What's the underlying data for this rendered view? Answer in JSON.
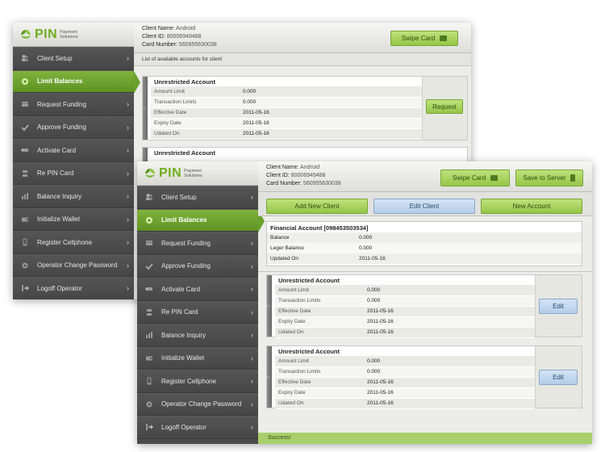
{
  "brand": {
    "logo": "PIN",
    "sub": "Payment Solutions",
    "accent": "#6fae1f"
  },
  "client": {
    "name_label": "Client Name:",
    "name": "Android",
    "id_label": "Client ID:",
    "id": "80006949488",
    "card_label": "Card Number:",
    "card": "560955630038"
  },
  "nav": [
    {
      "label": "Client Setup",
      "icon": "users-icon"
    },
    {
      "label": "Limit Balances",
      "icon": "balance-icon",
      "active": true
    },
    {
      "label": "Request Funding",
      "icon": "funding-icon"
    },
    {
      "label": "Approve Funding",
      "icon": "check-icon"
    },
    {
      "label": "Activate Card",
      "icon": "card-icon"
    },
    {
      "label": "Re PIN Card",
      "icon": "pin-icon"
    },
    {
      "label": "Balance Inquiry",
      "icon": "chart-icon"
    },
    {
      "label": "Initialize Wallet",
      "icon": "wallet-icon"
    },
    {
      "label": "Register Cellphone",
      "icon": "phone-icon"
    },
    {
      "label": "Operator Change Password",
      "icon": "lock-icon"
    },
    {
      "label": "Logoff Operator",
      "icon": "logout-icon"
    }
  ],
  "back": {
    "swipe_label": "Swipe Card",
    "list_caption": "List of available accounts for client",
    "request_label": "Request",
    "account1": {
      "title": "Unrestricted Account",
      "rows": [
        {
          "k": "Amount Limit",
          "v": "0.000"
        },
        {
          "k": "Transaction Limits",
          "v": "0.000"
        },
        {
          "k": "Effective Date",
          "v": "2011-05-16"
        },
        {
          "k": "Expiry Date",
          "v": "2011-05-16"
        },
        {
          "k": "Udated On",
          "v": "2011-05-16"
        }
      ]
    },
    "account2_title": "Unrestricted Account"
  },
  "front": {
    "swipe_label": "Swipe Card",
    "save_label": "Save to Server",
    "add_client_label": "Add New Client",
    "edit_client_label": "Edit Client",
    "new_account_label": "New Account",
    "financial": {
      "title": "Financial Account [098453503534]",
      "rows": [
        {
          "k": "Balance",
          "v": "0.000"
        },
        {
          "k": "Leger Balance",
          "v": "0.000"
        },
        {
          "k": "Updated On",
          "v": "2011-05-16"
        }
      ]
    },
    "accounts": [
      {
        "title": "Unrestricted Account",
        "edit_label": "Edit",
        "rows": [
          {
            "k": "Amount Limit",
            "v": "0.000"
          },
          {
            "k": "Transaction Limits",
            "v": "0.000"
          },
          {
            "k": "Effective Date",
            "v": "2011-05-16"
          },
          {
            "k": "Expiry Date",
            "v": "2011-05-16"
          },
          {
            "k": "Udated On",
            "v": "2011-05-16"
          }
        ]
      },
      {
        "title": "Unrestricted Account",
        "edit_label": "Edit",
        "rows": [
          {
            "k": "Amount Limit",
            "v": "0.000"
          },
          {
            "k": "Transaction Limits",
            "v": "0.000"
          },
          {
            "k": "Effective Date",
            "v": "2011-05-16"
          },
          {
            "k": "Expiry Date",
            "v": "2011-05-16"
          },
          {
            "k": "Udated On",
            "v": "2011-05-16"
          }
        ]
      }
    ],
    "status": "Success!"
  }
}
